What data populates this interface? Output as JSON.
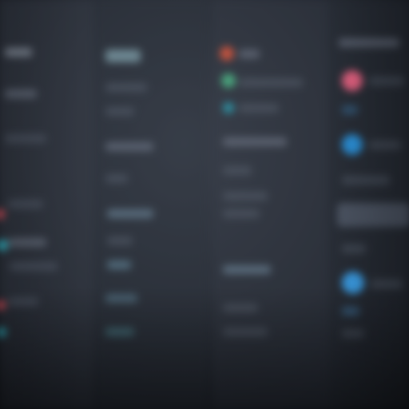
{
  "app": {
    "description_visible_text": ""
  },
  "colors": {
    "background_dark": "#1b1f27",
    "panel": "#3a404b",
    "accent_red": "#d9455a",
    "accent_pink": "#e0608a",
    "accent_blue": "#3aa0e0",
    "accent_teal": "#3fb8c8",
    "accent_green": "#59b38a"
  },
  "icons": {
    "col_c_top": "orange-dot-icon",
    "col_c_second": "teal-dot-icon",
    "col_d_first": "pink-avatar-icon",
    "col_d_second": "blue-avatar-icon",
    "col_d_third": "blue-avatar-icon",
    "col_a_side_1": "red-dot-icon",
    "col_a_side_2": "teal-dot-icon"
  }
}
